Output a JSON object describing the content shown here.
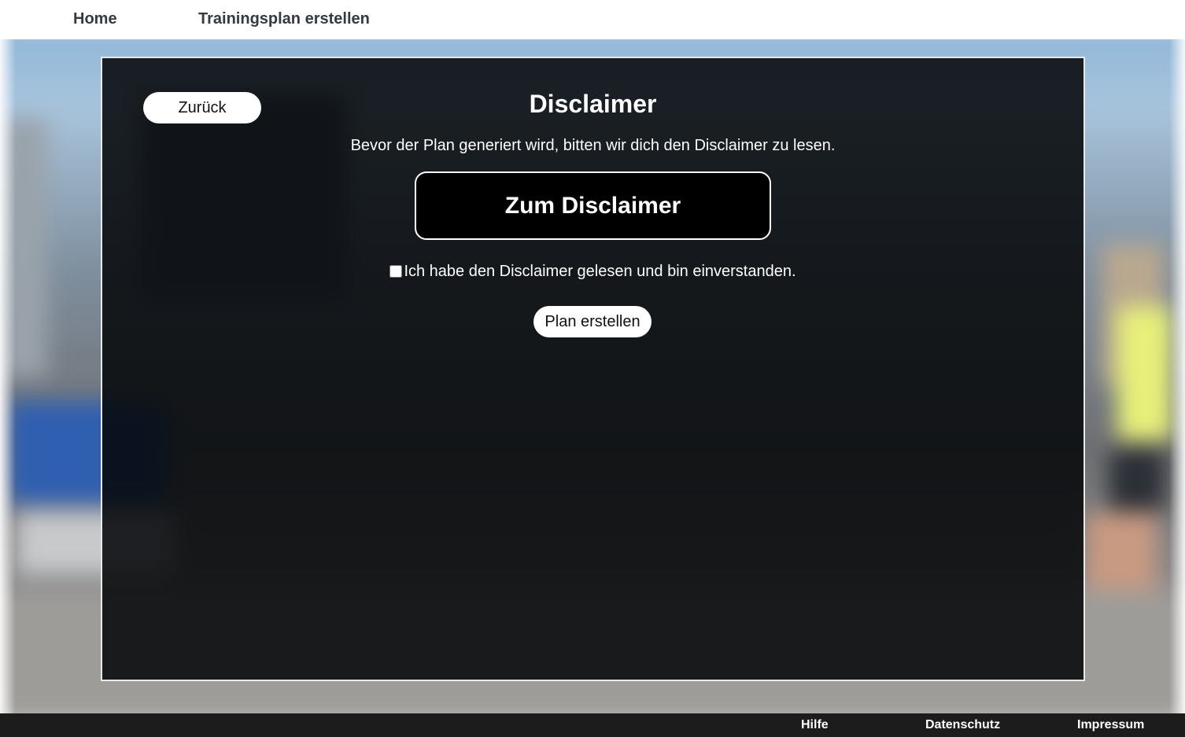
{
  "nav": {
    "home": "Home",
    "create_plan": "Trainingsplan erstellen"
  },
  "panel": {
    "back_label": "Zurück",
    "title": "Disclaimer",
    "intro": "Bevor der Plan generiert wird, bitten wir dich den Disclaimer zu lesen.",
    "disclaimer_button": "Zum Disclaimer",
    "consent_label": "Ich habe den Disclaimer gelesen und bin einverstanden.",
    "consent_checked": false,
    "create_button": "Plan erstellen"
  },
  "footer": {
    "help": "Hilfe",
    "privacy": "Datenschutz",
    "imprint": "Impressum"
  },
  "colors": {
    "panel_background": "#06080a",
    "footer_background": "#1c1c1c",
    "nav_text": "#333a44"
  }
}
